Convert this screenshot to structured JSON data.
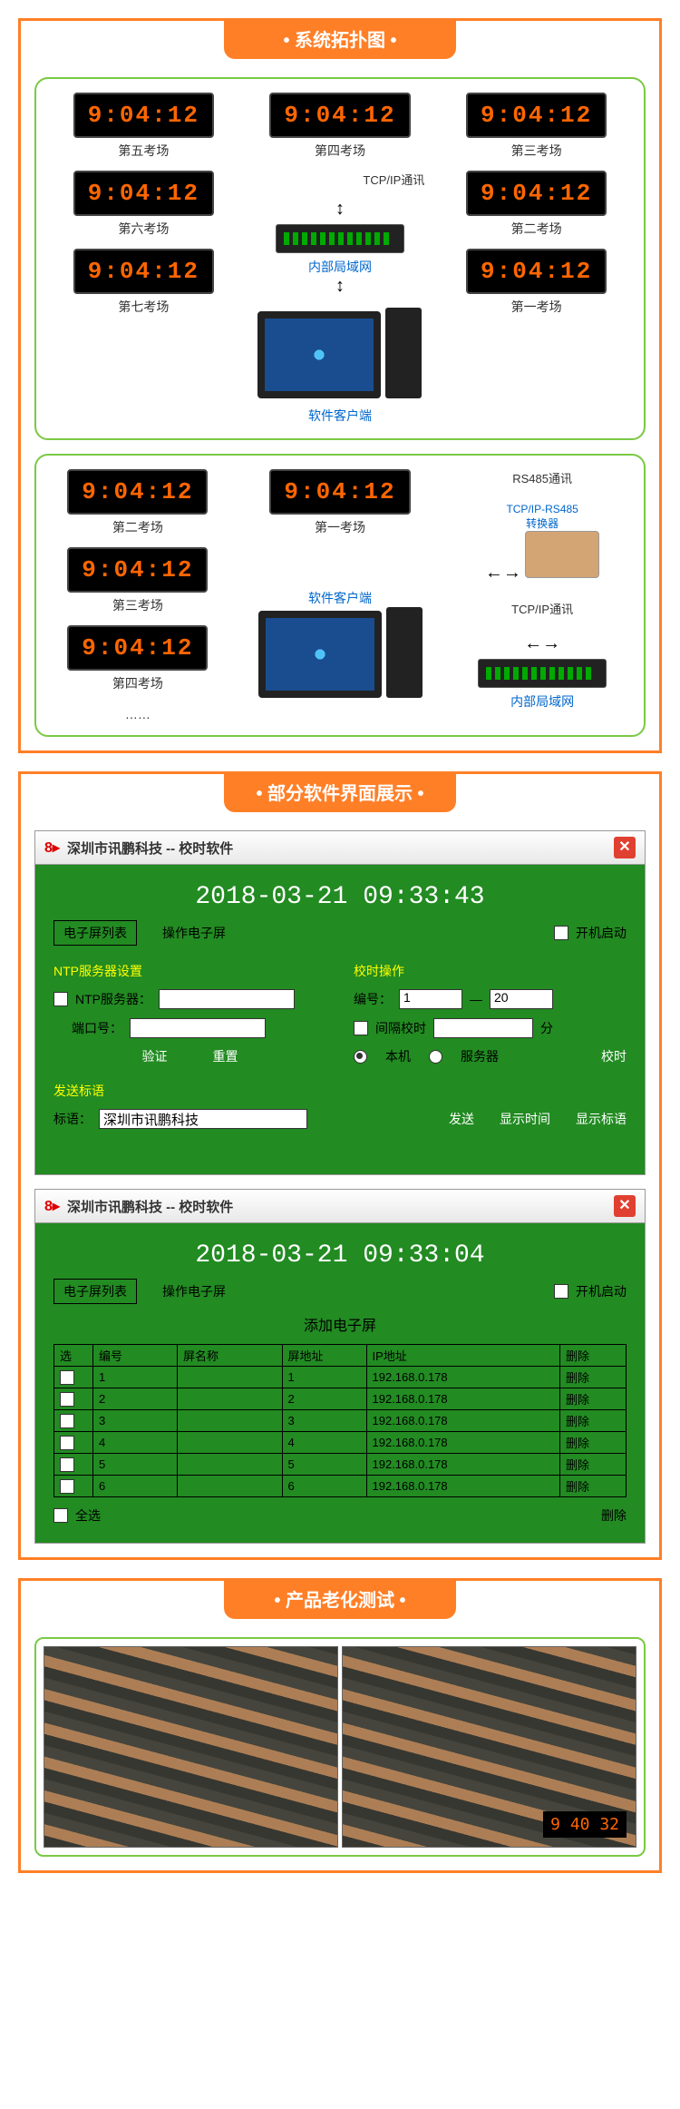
{
  "sections": {
    "topology": "系统拓扑图",
    "software": "部分软件界面展示",
    "aging": "产品老化测试"
  },
  "clock_time": "9:04:12",
  "topo1": {
    "rooms_left": [
      "第五考场",
      "第六考场",
      "第七考场"
    ],
    "rooms_right": [
      "第三考场",
      "第二考场",
      "第一考场"
    ],
    "center_top": "第四考场",
    "tcpip": "TCP/IP通讯",
    "lan": "内部局域网",
    "client": "软件客户端"
  },
  "topo2": {
    "rooms_left": [
      "第二考场",
      "第三考场",
      "第四考场",
      "……"
    ],
    "center_room": "第一考场",
    "rs485": "RS485通讯",
    "converter": "TCP/IP-RS485\n转换器",
    "tcpip": "TCP/IP通讯",
    "client": "软件客户端",
    "lan": "内部局域网"
  },
  "app1": {
    "title": "深圳市讯鹏科技  --  校时软件",
    "datetime": "2018-03-21  09:33:43",
    "btn_screen_list": "电子屏列表",
    "label_operate": "操作电子屏",
    "cb_autostart": "开机启动",
    "sec_ntp": "NTP服务器设置",
    "lbl_ntp": "NTP服务器：",
    "lbl_port": "端口号：",
    "btn_verify": "验证",
    "btn_reset": "重置",
    "sec_cal": "校时操作",
    "lbl_no": "编号：",
    "val_no_from": "1",
    "val_no_to": "20",
    "lbl_interval": "间隔校时",
    "lbl_min": "分",
    "radio_local": "本机",
    "radio_server": "服务器",
    "btn_calibrate": "校时",
    "sec_slogan": "发送标语",
    "lbl_slogan": "标语：",
    "val_slogan": "深圳市讯鹏科技",
    "btn_send": "发送",
    "btn_showtime": "显示时间",
    "btn_showslogan": "显示标语"
  },
  "app2": {
    "title": "深圳市讯鹏科技  --  校时软件",
    "datetime": "2018-03-21  09:33:04",
    "btn_screen_list": "电子屏列表",
    "label_operate": "操作电子屏",
    "cb_autostart": "开机启动",
    "table_title": "添加电子屏",
    "headers": {
      "sel": "选",
      "no": "编号",
      "name": "屏名称",
      "addr": "屏地址",
      "ip": "IP地址",
      "del": "删除"
    },
    "rows": [
      {
        "no": "1",
        "name": "",
        "addr": "1",
        "ip": "192.168.0.178",
        "del": "删除"
      },
      {
        "no": "2",
        "name": "",
        "addr": "2",
        "ip": "192.168.0.178",
        "del": "删除"
      },
      {
        "no": "3",
        "name": "",
        "addr": "3",
        "ip": "192.168.0.178",
        "del": "删除"
      },
      {
        "no": "4",
        "name": "",
        "addr": "4",
        "ip": "192.168.0.178",
        "del": "删除"
      },
      {
        "no": "5",
        "name": "",
        "addr": "5",
        "ip": "192.168.0.178",
        "del": "删除"
      },
      {
        "no": "6",
        "name": "",
        "addr": "6",
        "ip": "192.168.0.178",
        "del": "删除"
      }
    ],
    "select_all": "全选",
    "del_all": "删除"
  },
  "aging_clock": "9 40 32"
}
